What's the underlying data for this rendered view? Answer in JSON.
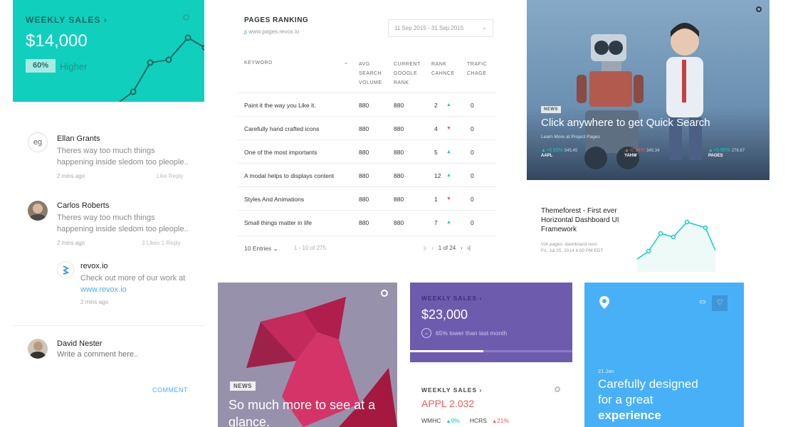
{
  "weekly_sales_1": {
    "title": "WEEKLY SALES",
    "amount": "$14,000",
    "percent": "60%",
    "trend_label": "Higher"
  },
  "comments": [
    {
      "initials": "eg",
      "name": "Ellan Grants",
      "text": "Theres way too much things happening inside sledom too pleople..",
      "time": "2 mins ago",
      "actions": "Like  Reply"
    },
    {
      "name": "Carlos Roberts",
      "text": "Theres way too much things happening inside sledom too pleople..",
      "time": "2 mins ago",
      "actions": "3 Likes   1 Reply"
    },
    {
      "name": "revox.io",
      "text": "Check out more of our work at",
      "link": "www.revox.io",
      "time": "2 mins ago"
    }
  ],
  "comment_box": {
    "name": "David Nester",
    "placeholder": "Write a comment here..",
    "submit": "COMMENT"
  },
  "pages_ranking": {
    "title": "PAGES RANKING",
    "url": "www.pages.revox.io",
    "date_range": "11 Sep 2015  -  31 Sep 2015",
    "columns": [
      "KEYWORD",
      "AVG SEARCH VOLUME",
      "CURRENT GOOGLE RANK",
      "RANK CAHNCE",
      "TRAFIC CHAGE"
    ],
    "rows": [
      {
        "keyword": "Paint it the way you Like it.",
        "volume": "880",
        "google": "880",
        "rank": "2",
        "dir": "up",
        "traffic": "0"
      },
      {
        "keyword": "Carefully hand crafted icons",
        "volume": "880",
        "google": "880",
        "rank": "4",
        "dir": "down",
        "traffic": "0"
      },
      {
        "keyword": "One of the most importants",
        "volume": "880",
        "google": "880",
        "rank": "5",
        "dir": "up",
        "traffic": "0"
      },
      {
        "keyword": "A modal helps to displays content",
        "volume": "880",
        "google": "880",
        "rank": "12",
        "dir": "up",
        "traffic": "0"
      },
      {
        "keyword": "Styles And Animations",
        "volume": "880",
        "google": "880",
        "rank": "1",
        "dir": "down",
        "traffic": "0"
      },
      {
        "keyword": "Small things matter in life",
        "volume": "880",
        "google": "880",
        "rank": "7",
        "dir": "up",
        "traffic": "0"
      }
    ],
    "entries": "10 Entries",
    "range": "1 - 10 of 275",
    "page": "1 of 24"
  },
  "robot_card": {
    "badge": "NEWS",
    "headline": "Click anywhere to get Quick Search",
    "sub": "Learn More at Project Pages",
    "stocks": [
      {
        "symbol": "AAPL",
        "change": "+0.95%",
        "value": "545.45",
        "dir": "up"
      },
      {
        "symbol": "YAHW",
        "change": "-0.34%",
        "value": "345.34",
        "dir": "down"
      },
      {
        "symbol": "PAGES",
        "change": "+0.95%",
        "value": "278.87",
        "dir": "up"
      }
    ]
  },
  "themeforest": {
    "title": "Themeforest - First ever Horizontal Dashboard UI Framework",
    "via": "VIA pages- dashboard revo",
    "date": "Fri, Jul 25, 2014 4:00 PM EDT"
  },
  "pink_card": {
    "badge": "NEWS",
    "headline": "So much more to see at a glance."
  },
  "purple_card": {
    "title": "WEEKLY SALES",
    "amount": "$23,000",
    "sub": "65% lower than last month",
    "progress": 0.45
  },
  "weekly_sales_2": {
    "title": "WEEKLY SALES",
    "value": "APPL 2.032",
    "stocks": [
      {
        "symbol": "WMHC",
        "change": "9%",
        "dir": "up"
      },
      {
        "symbol": "HCRS",
        "change": "21%",
        "dir": "up"
      }
    ]
  },
  "blue_card": {
    "date": "21 Jan",
    "text_prefix": "Carefully designed for a great ",
    "text_emph": "experience"
  },
  "colors": {
    "teal": "#10cfbd",
    "purple": "#6d5cae",
    "blue": "#48b0f7",
    "red": "#f55753"
  }
}
